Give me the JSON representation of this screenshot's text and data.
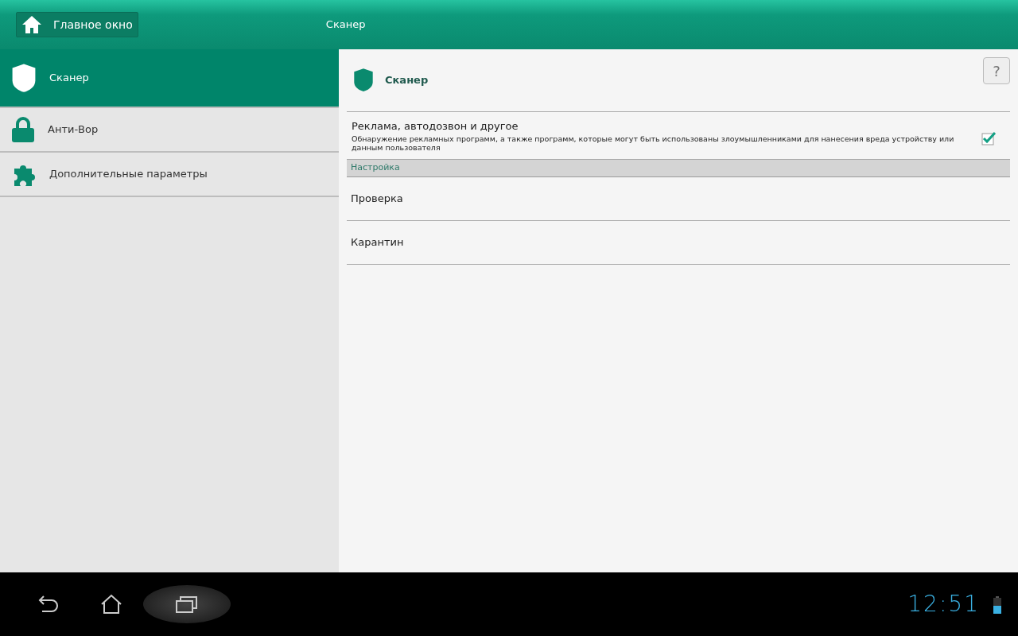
{
  "header": {
    "home_button": "Главное окно",
    "title": "Сканер"
  },
  "sidebar": {
    "items": [
      {
        "kind": "shield",
        "label": "Сканер",
        "selected": true
      },
      {
        "kind": "lock",
        "label": "Анти-Вор",
        "selected": false
      },
      {
        "kind": "puzzle",
        "label": "Дополнительные параметры",
        "selected": false
      }
    ]
  },
  "content": {
    "title": "Сканер",
    "help_button": "?",
    "option": {
      "title": "Реклама, автодозвон и другое",
      "description": "Обнаружение рекламных программ, а также программ, которые могут быть использованы злоумышленниками для нанесения вреда устройству или данным пользователя",
      "checked": true
    },
    "section": "Настройка",
    "items": [
      "Проверка",
      "Карантин"
    ]
  },
  "system_bar": {
    "buttons": [
      {
        "kind": "back",
        "highlighted": false
      },
      {
        "kind": "home",
        "highlighted": false
      },
      {
        "kind": "recents",
        "highlighted": true
      }
    ],
    "time": "12:51"
  }
}
